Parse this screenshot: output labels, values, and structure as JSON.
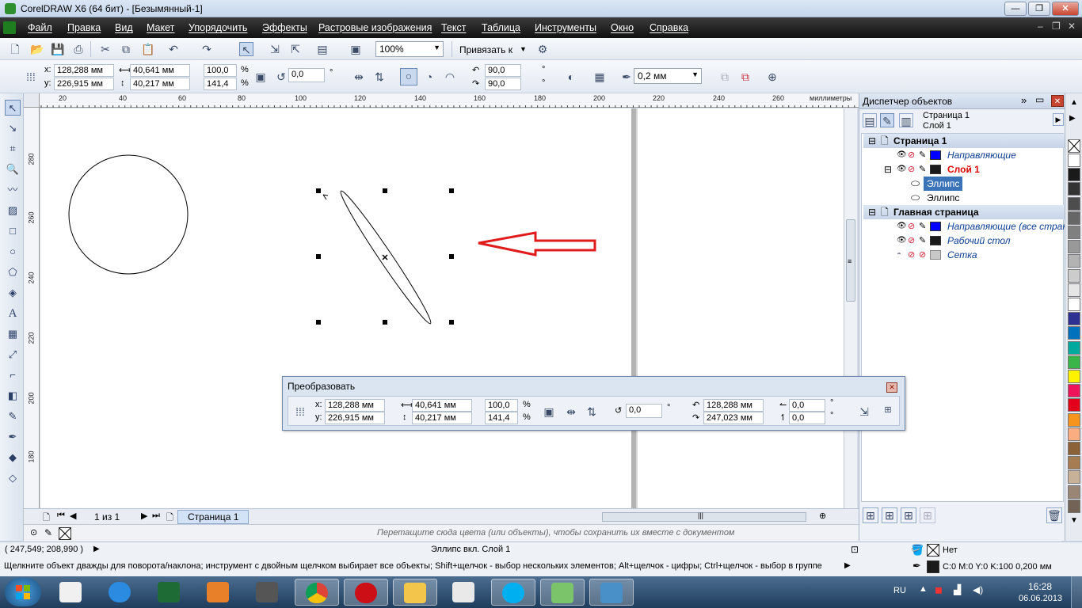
{
  "window": {
    "title": "CorelDRAW X6 (64 бит) - [Безымянный-1]"
  },
  "menu": [
    "Файл",
    "Правка",
    "Вид",
    "Макет",
    "Упорядочить",
    "Эффекты",
    "Растровые изображения",
    "Текст",
    "Таблица",
    "Инструменты",
    "Окно",
    "Справка"
  ],
  "toolbar": {
    "zoom": "100%",
    "snap_label": "Привязать к"
  },
  "property_bar": {
    "x_label": "x:",
    "x": "128,288 мм",
    "y_label": "y:",
    "y": "226,915 мм",
    "width": "40,641 мм",
    "height": "40,217 мм",
    "scale_x": "100,0",
    "scale_y": "141,4",
    "percent": "%",
    "rotation": "0,0",
    "degree": "°",
    "angle_start": "90,0",
    "angle_end": "90,0",
    "outline_width": "0,2 мм"
  },
  "ruler": {
    "h_ticks": [
      "20",
      "40",
      "60",
      "80",
      "100",
      "120",
      "140",
      "160",
      "180",
      "200",
      "220",
      "240",
      "260"
    ],
    "v_ticks": [
      "280",
      "260",
      "240",
      "220",
      "200",
      "180"
    ],
    "unit": "миллиметры"
  },
  "page_nav": {
    "counter": "1 из 1",
    "tab": "Страница 1"
  },
  "palette_hint": "Перетащите сюда цвета (или объекты), чтобы сохранить их вместе с документом",
  "transform_dialog": {
    "title": "Преобразовать",
    "x_label": "x:",
    "x": "128,288 мм",
    "y_label": "y:",
    "y": "226,915 мм",
    "width": "40,641 мм",
    "height": "40,217 мм",
    "scale_x": "100,0",
    "scale_y": "141,4",
    "percent": "%",
    "rotation": "0,0",
    "degree": "°",
    "center_x": "128,288 мм",
    "center_y": "247,023 мм",
    "skew_h": "0,0",
    "skew_v": "0,0"
  },
  "object_manager": {
    "title": "Диспетчер объектов",
    "current_page": "Страница 1",
    "current_layer": "Слой 1",
    "tree": [
      {
        "kind": "head",
        "label": "Страница 1"
      },
      {
        "kind": "layer",
        "label": "Направляющие",
        "color": "#0000ff",
        "style": "italic"
      },
      {
        "kind": "layer",
        "label": "Слой 1",
        "color": "#1a1a1a",
        "style": "active"
      },
      {
        "kind": "object",
        "label": "Эллипс",
        "selected": true
      },
      {
        "kind": "object",
        "label": "Эллипс",
        "selected": false
      },
      {
        "kind": "head",
        "label": "Главная страница"
      },
      {
        "kind": "layer",
        "label": "Направляющие (все стран",
        "color": "#0000ff",
        "style": "italic"
      },
      {
        "kind": "layer",
        "label": "Рабочий стол",
        "color": "#1a1a1a",
        "style": "italic"
      },
      {
        "kind": "layer",
        "label": "Сетка",
        "color": "#c8c8c8",
        "style": "italic"
      }
    ]
  },
  "status": {
    "coords": "( 247,549; 208,990 )",
    "object_info": "Эллипс вкл. Слой 1",
    "hint": "Щелкните объект дважды для поворота/наклона; инструмент с двойным щелчком выбирает все объекты; Shift+щелчок - выбор нескольких элементов; Alt+щелчок - цифры; Ctrl+щелчок - выбор в группе",
    "fill": "Нет",
    "outline": "C:0 M:0 Y:0 K:100  0,200 мм"
  },
  "taskbar": {
    "lang": "RU",
    "time": "16:28",
    "date": "06.06.2013"
  },
  "palette_colors": [
    "#ffffff",
    "#1a1a1a",
    "#333333",
    "#4d4d4d",
    "#666666",
    "#808080",
    "#999999",
    "#b3b3b3",
    "#cccccc",
    "#e6e6e6",
    "#ffffff",
    "#2e3192",
    "#0071bc",
    "#00a99d",
    "#39b54a",
    "#fff200",
    "#ed145b",
    "#e2001a",
    "#f7941d",
    "#f9ad81",
    "#8c6239",
    "#a67c52",
    "#c7b299",
    "#998675",
    "#736357"
  ],
  "colors": {
    "accent": "#3a73b8",
    "arrow": "#e01b1b",
    "layer_active": "#e00000"
  }
}
